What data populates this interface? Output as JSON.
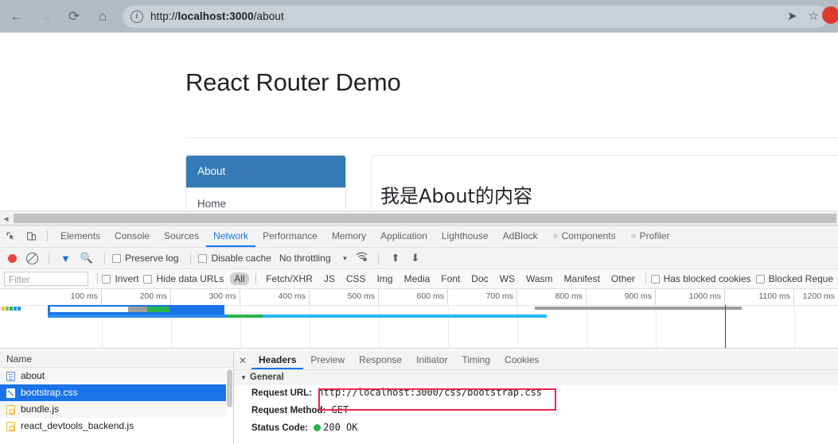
{
  "browser": {
    "nav": {
      "back": "←",
      "forward": "→",
      "reload": "⟳",
      "home": "⌂"
    },
    "omnibox": {
      "info_icon": "i",
      "url_scheme": "http://",
      "url_host": "localhost:3000",
      "url_path": "/about",
      "full_url": "http://localhost:3000/about",
      "send_icon": "➤",
      "bookmark_icon": "☆"
    }
  },
  "page": {
    "title": "React Router Demo",
    "nav_items": [
      {
        "label": "About",
        "active": true
      },
      {
        "label": "Home",
        "active": false
      }
    ],
    "content": "我是About的内容"
  },
  "devtools": {
    "panel_tabs": [
      {
        "label": "Elements",
        "active": false
      },
      {
        "label": "Console",
        "active": false
      },
      {
        "label": "Sources",
        "active": false
      },
      {
        "label": "Network",
        "active": true
      },
      {
        "label": "Performance",
        "active": false
      },
      {
        "label": "Memory",
        "active": false
      },
      {
        "label": "Application",
        "active": false
      },
      {
        "label": "Lighthouse",
        "active": false
      },
      {
        "label": "AdBlock",
        "active": false
      },
      {
        "label": "Components",
        "active": false,
        "icon": "react-icon"
      },
      {
        "label": "Profiler",
        "active": false,
        "icon": "react-icon"
      }
    ],
    "toolbar": {
      "record_title": "record-button",
      "clear_title": "clear-button",
      "filter_title": "filter-button",
      "search_title": "search-button",
      "preserve_log": "Preserve log",
      "preserve_log_checked": false,
      "disable_cache": "Disable cache",
      "disable_cache_checked": false,
      "throttling": "No throttling",
      "caret": "▼",
      "wifi_icon": "wifi-settings-icon",
      "upload_icon": "⬆",
      "download_icon": "⬇"
    },
    "filterbar": {
      "filter_placeholder": "Filter",
      "filter_value": "",
      "invert": "Invert",
      "invert_checked": false,
      "hide_data_urls": "Hide data URLs",
      "hide_data_urls_checked": false,
      "types": [
        {
          "label": "All",
          "active": true
        },
        {
          "label": "Fetch/XHR",
          "active": false
        },
        {
          "label": "JS",
          "active": false
        },
        {
          "label": "CSS",
          "active": false
        },
        {
          "label": "Img",
          "active": false
        },
        {
          "label": "Media",
          "active": false
        },
        {
          "label": "Font",
          "active": false
        },
        {
          "label": "Doc",
          "active": false
        },
        {
          "label": "WS",
          "active": false
        },
        {
          "label": "Wasm",
          "active": false
        },
        {
          "label": "Manifest",
          "active": false
        },
        {
          "label": "Other",
          "active": false
        }
      ],
      "has_blocked_cookies": "Has blocked cookies",
      "has_blocked_cookies_checked": false,
      "blocked_requests": "Blocked Reque",
      "blocked_requests_checked": false
    },
    "timeline": {
      "ticks": [
        "100 ms",
        "200 ms",
        "300 ms",
        "400 ms",
        "500 ms",
        "600 ms",
        "700 ms",
        "800 ms",
        "900 ms",
        "1000 ms",
        "1100 ms",
        "1200 ms"
      ]
    },
    "requests": {
      "column_header": "Name",
      "rows": [
        {
          "name": "about",
          "type": "doc",
          "selected": false
        },
        {
          "name": "bootstrap.css",
          "type": "css",
          "selected": true
        },
        {
          "name": "bundle.js",
          "type": "js",
          "selected": false
        },
        {
          "name": "react_devtools_backend.js",
          "type": "js",
          "selected": false
        }
      ]
    },
    "detail": {
      "close_icon": "✕",
      "tabs": [
        {
          "label": "Headers",
          "active": true
        },
        {
          "label": "Preview",
          "active": false
        },
        {
          "label": "Response",
          "active": false
        },
        {
          "label": "Initiator",
          "active": false
        },
        {
          "label": "Timing",
          "active": false
        },
        {
          "label": "Cookies",
          "active": false
        }
      ],
      "section_title": "General",
      "section_triangle": "▼",
      "request_url_label": "Request URL:",
      "request_url_value": "http://localhost:3000/css/bootstrap.css",
      "request_method_label": "Request Method:",
      "request_method_value": "GET",
      "status_code_label": "Status Code:",
      "status_code_value": "200  OK"
    }
  },
  "colors": {
    "accent_blue": "#1a73e8",
    "bootstrap_primary": "#337ab7",
    "record_red": "#e8453c",
    "annotation_red": "#f4234c",
    "status_green": "#2ab34a",
    "chrome_bar": "#b3bcc4"
  }
}
